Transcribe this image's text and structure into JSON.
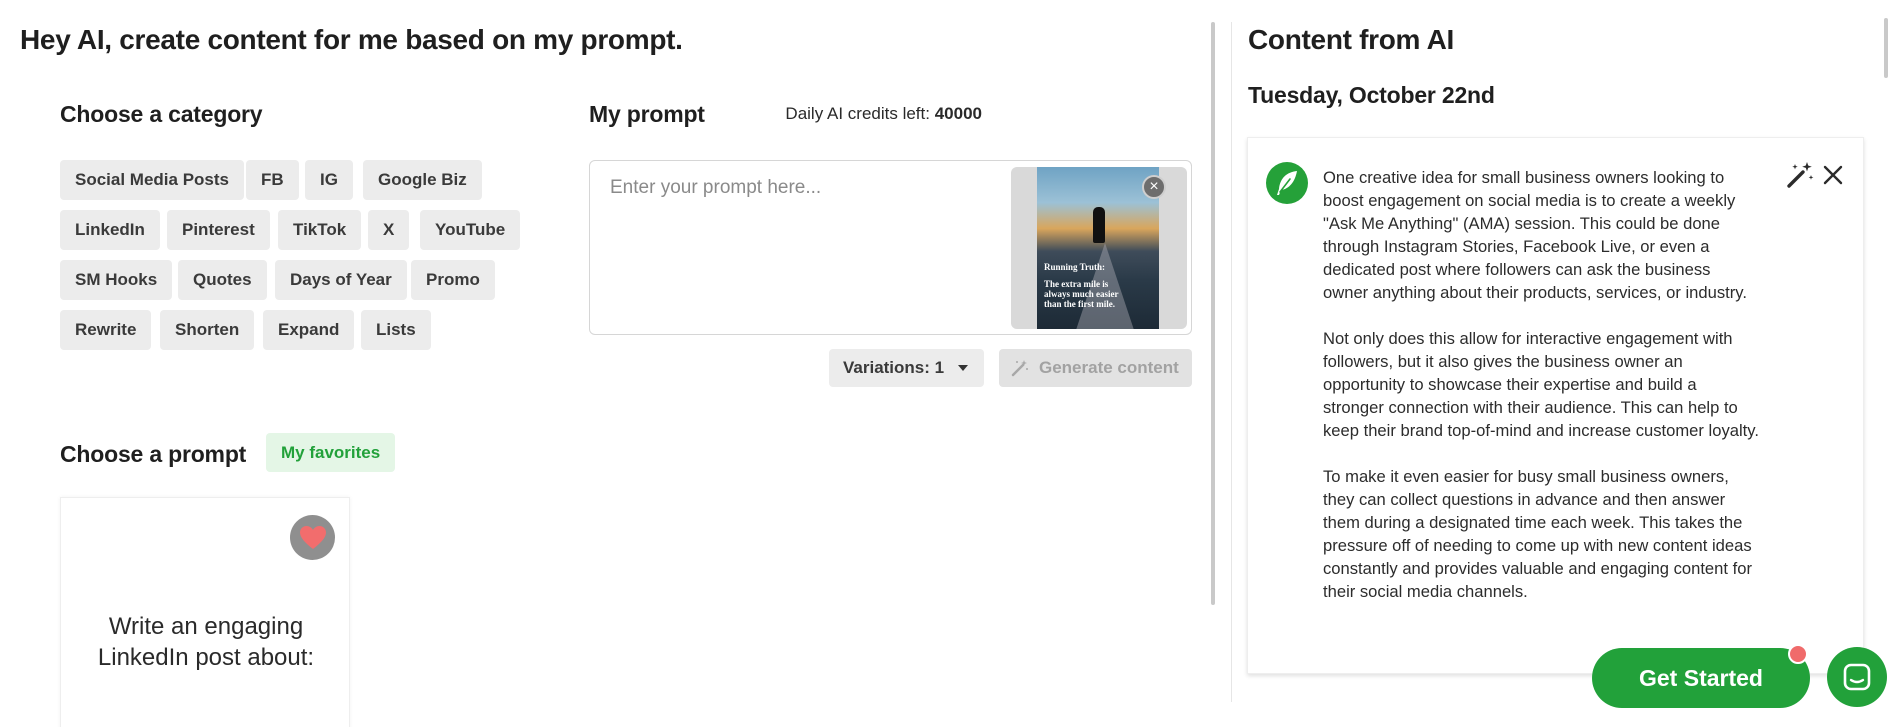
{
  "header": {
    "title": "Hey AI, create content for me based on my prompt."
  },
  "categories": {
    "title": "Choose a category",
    "chips": [
      "Social Media Posts",
      "FB",
      "IG",
      "Google Biz",
      "LinkedIn",
      "Pinterest",
      "TikTok",
      "X",
      "YouTube",
      "SM Hooks",
      "Quotes",
      "Days of Year",
      "Promo",
      "Rewrite",
      "Shorten",
      "Expand",
      "Lists"
    ]
  },
  "my_prompt": {
    "title": "My prompt",
    "credits_label": "Daily AI credits left:",
    "credits_value": "40000",
    "placeholder": "Enter your prompt here...",
    "image": {
      "text_title": "Running Truth:",
      "text_body": "The extra mile is always much easier than the first mile."
    },
    "variations_label": "Variations: 1",
    "generate_label": "Generate content"
  },
  "choose_prompt": {
    "title": "Choose a prompt",
    "favorites_label": "My favorites",
    "card_text": "Write an engaging LinkedIn post about:"
  },
  "content_panel": {
    "title": "Content from AI",
    "date": "Tuesday, October 22nd",
    "paragraphs": [
      "One creative idea for small business owners looking to boost engagement on social media is to create a weekly \"Ask Me Anything\" (AMA) session. This could be done through Instagram Stories, Facebook Live, or even a dedicated post where followers can ask the business owner anything about their products, services, or industry.",
      "Not only does this allow for interactive engagement with followers, but it also gives the business owner an opportunity to showcase their expertise and build a stronger connection with their audience. This can help to keep their brand top-of-mind and increase customer loyalty.",
      "To make it even easier for busy small business owners, they can collect questions in advance and then answer them during a designated time each week. This takes the pressure off of needing to come up with new content ideas constantly and provides valuable and engaging content for their social media channels."
    ]
  },
  "cta": {
    "get_started_label": "Get Started"
  },
  "colors": {
    "accent": "#22a13a",
    "chip_bg": "#ececec",
    "notification": "#f06b6b"
  },
  "icons": [
    "close-icon",
    "chevron-down-icon",
    "magic-wand-icon",
    "heart-icon",
    "feather-icon",
    "chat-icon"
  ]
}
